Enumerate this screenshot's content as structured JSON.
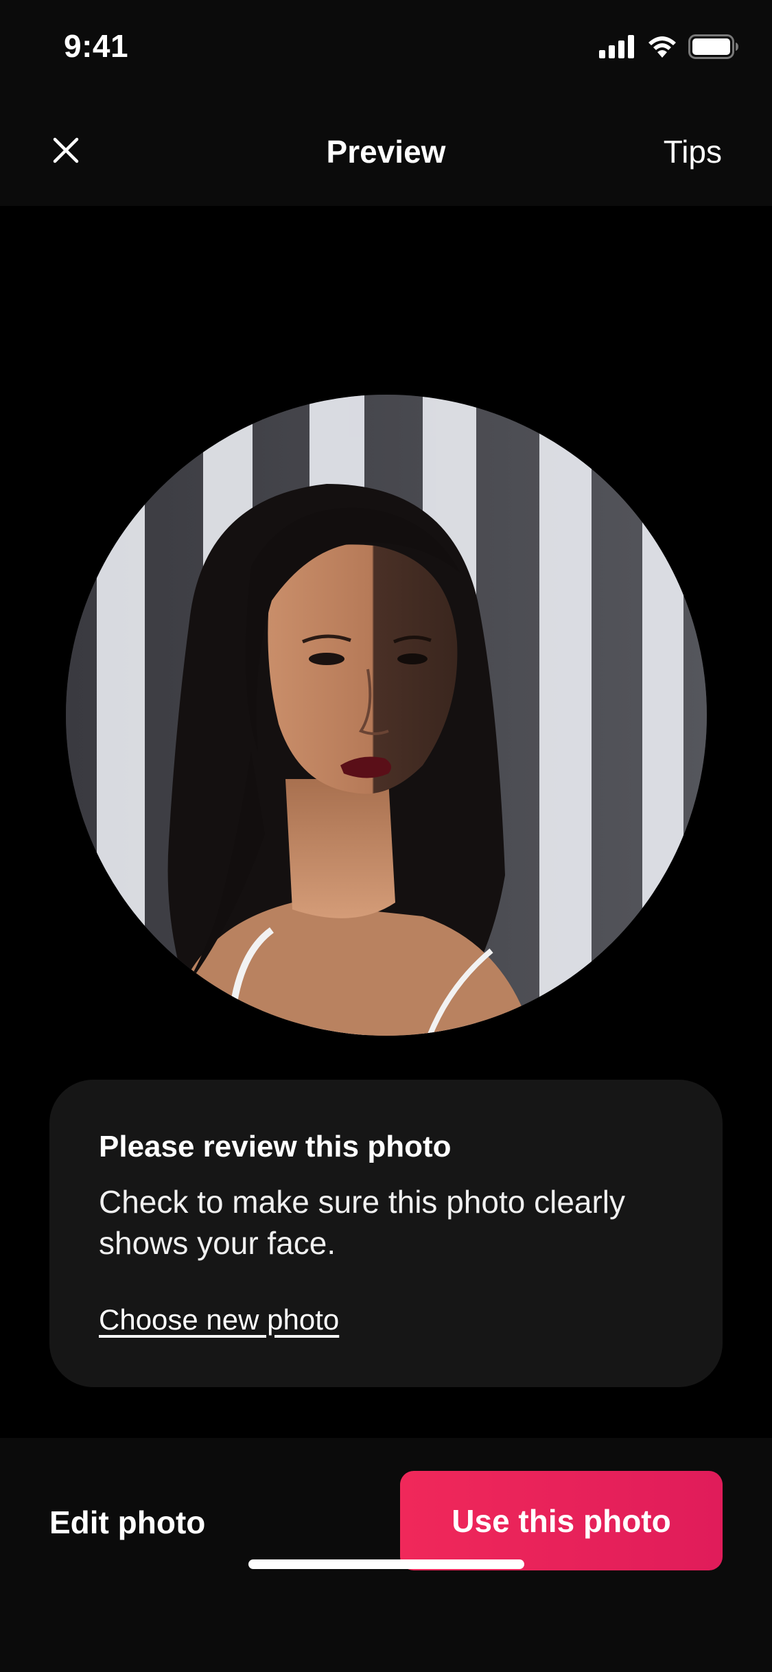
{
  "status_bar": {
    "time": "9:41",
    "icons": [
      "cellular-signal-icon",
      "wifi-icon",
      "battery-icon"
    ]
  },
  "nav": {
    "close_icon": "close-icon",
    "title": "Preview",
    "tips_label": "Tips"
  },
  "photo": {
    "description": "profile-photo-preview"
  },
  "review_card": {
    "title": "Please review this photo",
    "body": "Check to make sure this photo clearly shows your face.",
    "link_label": "Choose new photo"
  },
  "bottom_bar": {
    "edit_label": "Edit photo",
    "use_label": "Use this photo"
  },
  "colors": {
    "background": "#000000",
    "bar_background": "#0b0b0b",
    "card_background": "#161616",
    "accent": "#e61e5a"
  }
}
